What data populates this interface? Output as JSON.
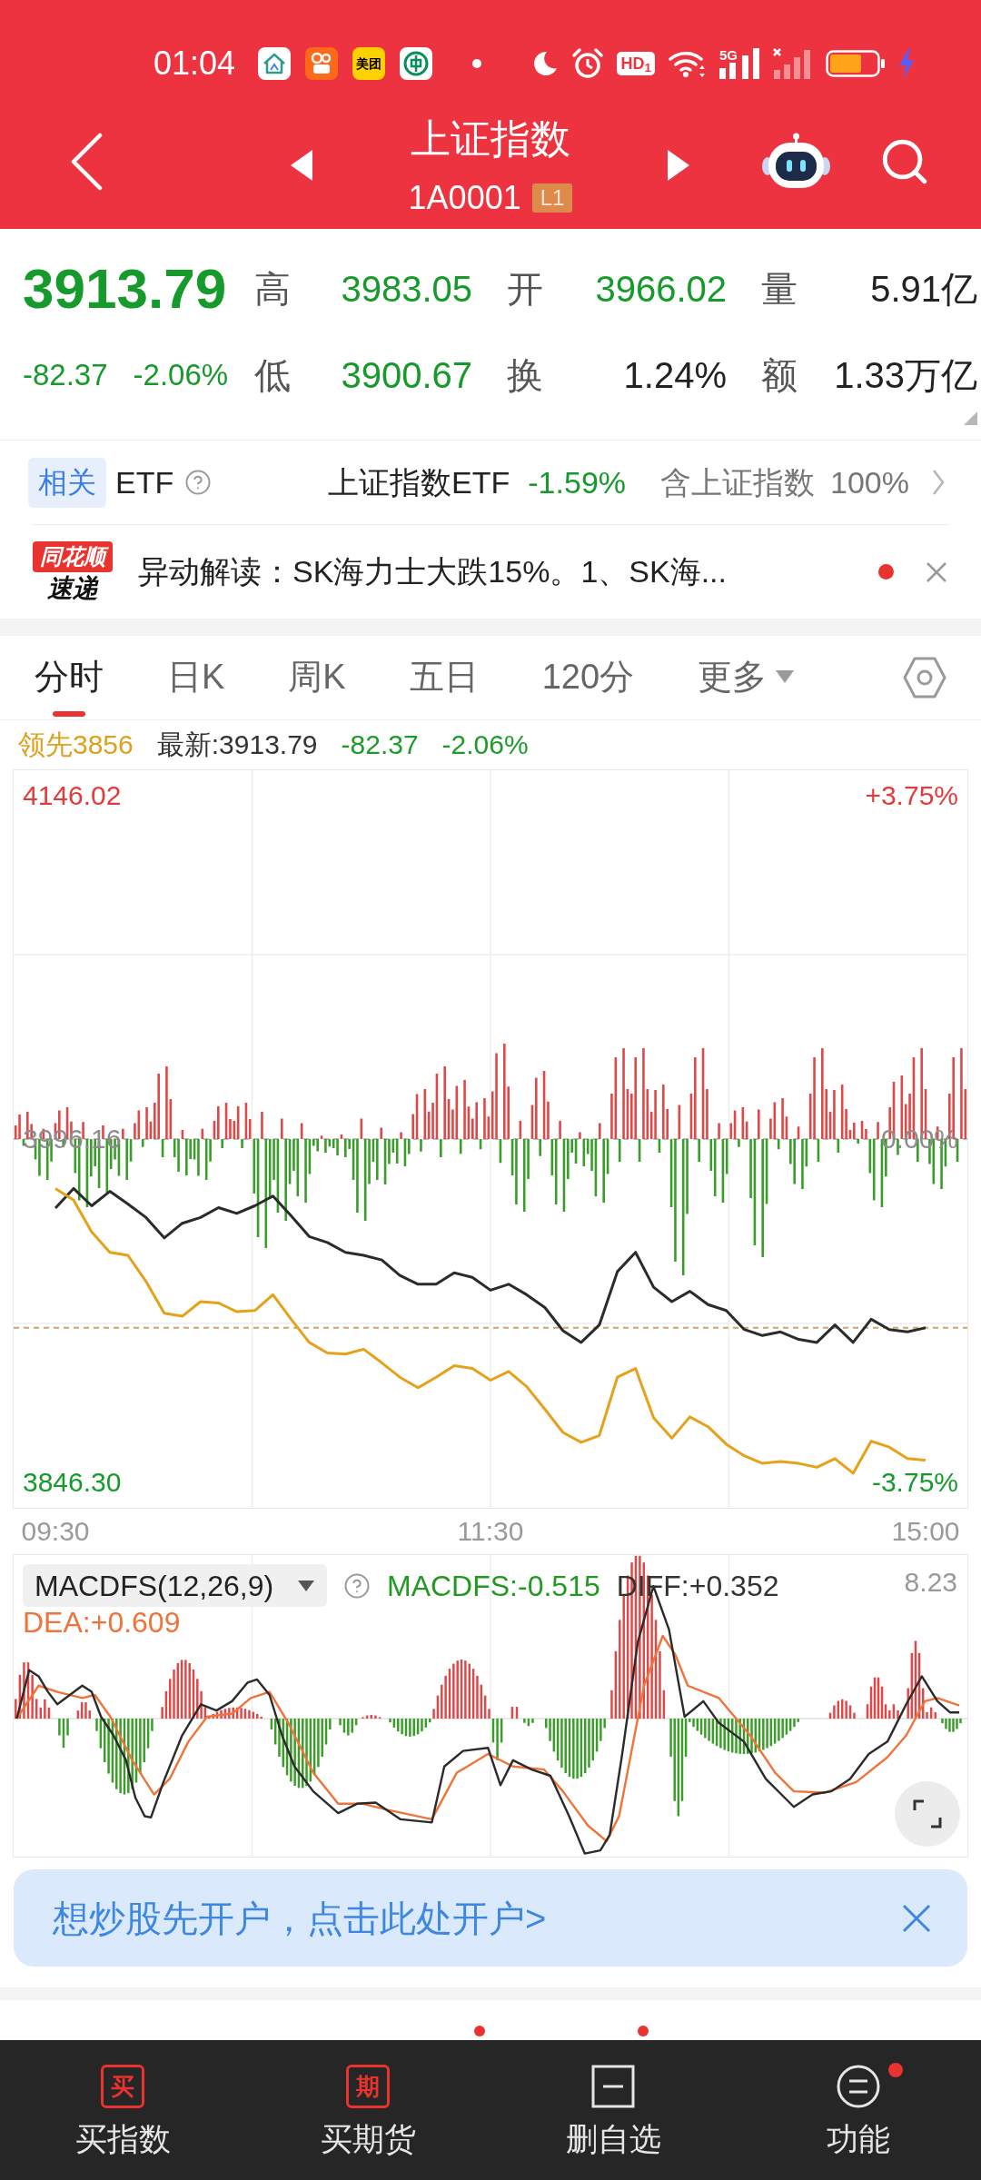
{
  "status_bar": {
    "time": "01:04",
    "app_icons": [
      {
        "kind": "house"
      },
      {
        "kind": "video"
      },
      {
        "kind": "label",
        "label": "美团"
      },
      {
        "kind": "bank"
      }
    ],
    "hd_badge": "HD$_{1}$",
    "network": "5G"
  },
  "header": {
    "title": "上证指数",
    "code": "1A0001",
    "level_badge": "L1"
  },
  "quote": {
    "price": "3913.79",
    "change": "-82.37",
    "change_pct": "-2.06%",
    "falling": true
  },
  "stats": [
    {
      "label": "高",
      "value": "3983.05",
      "color": "#159a2b"
    },
    {
      "label": "开",
      "value": "3966.02",
      "color": "#159a2b"
    },
    {
      "label": "量",
      "value": "5.91亿",
      "color": "#222222"
    },
    {
      "label": "低",
      "value": "3900.67",
      "color": "#159a2b"
    },
    {
      "label": "换",
      "value": "1.24%",
      "color": "#222222"
    },
    {
      "label": "额",
      "value": "1.33万亿",
      "color": "#222222"
    }
  ],
  "etf": {
    "tag": "相关",
    "label": "ETF",
    "fund": "上证指数ETF",
    "change": "-1.59%",
    "falling": true,
    "holding_label": "含上证指数",
    "holding_pct": "100%"
  },
  "news": {
    "logo_top": "同花顺",
    "logo_bottom": "速递",
    "headline": "异动解读：SK海力士大跌15%。1、SK海...",
    "unread": true
  },
  "tabs": [
    {
      "label": "分时",
      "kind": "tab",
      "selected": true
    },
    {
      "label": "日K",
      "kind": "tab",
      "selected": false
    },
    {
      "label": "周K",
      "kind": "tab",
      "selected": false
    },
    {
      "label": "五日",
      "kind": "tab",
      "selected": false
    },
    {
      "label": "120分",
      "kind": "tab",
      "selected": false
    },
    {
      "label": "更多",
      "kind": "menu",
      "selected": false
    }
  ],
  "legend": [
    {
      "text": "领先3856",
      "color": "#dca11d"
    },
    {
      "text": "最新:3913.79",
      "color": "#333333"
    },
    {
      "text": "-82.37",
      "color": "#1f9b2a"
    },
    {
      "text": "-2.06%",
      "color": "#1f9b2a"
    }
  ],
  "chart": {
    "percent_labels": [
      "+3.75%",
      "0.00%",
      "-3.75%"
    ],
    "chart_data": {
      "type": "line",
      "categories": [
        "09:30",
        null,
        null,
        null,
        null,
        null,
        null,
        null,
        null,
        null,
        null,
        null,
        null,
        null,
        null,
        null,
        null,
        null,
        null,
        null,
        null,
        null,
        null,
        null,
        "11:30",
        null,
        null,
        null,
        null,
        null,
        null,
        null,
        null,
        null,
        null,
        null,
        null,
        null,
        null,
        null,
        null,
        null,
        null,
        null,
        null,
        null,
        null,
        null,
        "15:00"
      ],
      "ylim": [
        3835.2,
        4157.1
      ],
      "yticks": [
        {
          "value": 4146.02,
          "label": "4146.02"
        },
        {
          "value": 3996.16,
          "label": "3996.16"
        },
        {
          "value": 3846.3,
          "label": "3846.30"
        }
      ],
      "series": [
        {
          "color": "#2b2b2b",
          "values": [
            3966.0,
            3974.6,
            3967.0,
            3973.3,
            3967.8,
            3961.9,
            3953.0,
            3959.4,
            3961.9,
            3966.2,
            3963.7,
            3967.0,
            3971.3,
            3962.7,
            3953.6,
            3951.0,
            3946.7,
            3945.4,
            3943.4,
            3936.6,
            3932.8,
            3932.8,
            3937.8,
            3935.8,
            3930.2,
            3932.8,
            3928.2,
            3922.6,
            3912.5,
            3907.4,
            3915.0,
            3938.3,
            3946.7,
            3931.5,
            3925.2,
            3929.7,
            3923.9,
            3921.3,
            3913.0,
            3910.4,
            3912.0,
            3908.7,
            3907.4,
            3915.0,
            3907.4,
            3917.5,
            3913.0,
            3912.0,
            3913.8
          ]
        },
        {
          "color": "#e5a11a",
          "values": [
            3974.6,
            3969.5,
            3955.6,
            3946.7,
            3945.4,
            3934.0,
            3920.1,
            3918.8,
            3925.2,
            3924.6,
            3920.8,
            3921.3,
            3928.2,
            3917.5,
            3907.4,
            3902.8,
            3902.3,
            3904.4,
            3898.5,
            3892.2,
            3887.6,
            3892.2,
            3897.3,
            3896.0,
            3890.9,
            3894.7,
            3888.1,
            3878.2,
            3868.1,
            3863.8,
            3866.8,
            3892.2,
            3896.0,
            3874.4,
            3865.6,
            3874.9,
            3870.6,
            3863.0,
            3857.9,
            3854.6,
            3855.4,
            3854.6,
            3852.9,
            3856.7,
            3850.3,
            3864.3,
            3861.7,
            3856.7,
            3856.0
          ]
        }
      ]
    }
  },
  "macd": {
    "indicator": "MACDFS(12,26,9)",
    "readings": [
      {
        "text": "MACDFS:-0.515",
        "color": "#229a22"
      },
      {
        "text": "DIFF:+0.352",
        "color": "#333333"
      },
      {
        "text": "DEA:+0.609",
        "color": "#f0733a"
      }
    ],
    "scale_label": "8.23"
  },
  "promo": {
    "text": "想炒股先开户，点击此处开户>"
  },
  "section_tabs": [
    {
      "badge": false
    },
    {
      "badge": false
    },
    {
      "badge": true
    },
    {
      "badge": true
    },
    {
      "badge": false
    },
    {
      "badge": false
    }
  ],
  "nav": [
    {
      "label": "买指数",
      "kind": "char",
      "icon_text": "买",
      "badge": false
    },
    {
      "label": "买期货",
      "kind": "char",
      "icon_text": "期",
      "badge": false
    },
    {
      "label": "删自选",
      "kind": "minus",
      "badge": false
    },
    {
      "label": "功能",
      "kind": "menu",
      "badge": true
    }
  ]
}
